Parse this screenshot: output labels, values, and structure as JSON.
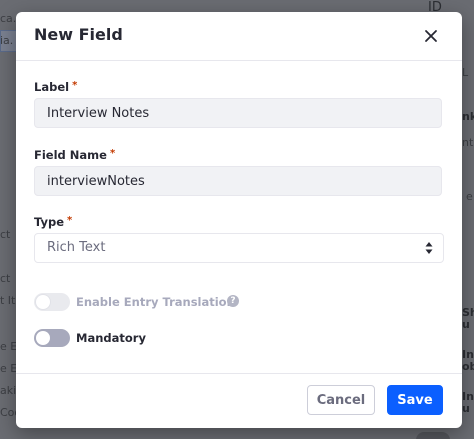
{
  "modal": {
    "title": "New Field",
    "close_icon": "close-icon"
  },
  "form": {
    "label_field": {
      "label": "Label",
      "required_mark": "*",
      "value": "Interview Notes"
    },
    "field_name": {
      "label": "Field Name",
      "required_mark": "*",
      "value": "interviewNotes"
    },
    "type_field": {
      "label": "Type",
      "required_mark": "*",
      "selected": "Rich Text",
      "icon": "select-arrows-icon"
    },
    "enable_entry_translation": {
      "label": "Enable Entry Translation",
      "enabled": false,
      "disabled": true,
      "help_icon": "question-circle-icon",
      "help_glyph": "?"
    },
    "mandatory": {
      "label": "Mandatory",
      "enabled": false
    }
  },
  "footer": {
    "cancel_label": "Cancel",
    "save_label": "Save"
  },
  "background": {
    "fragments": [
      "ID",
      "ca.",
      "ia.",
      "L",
      "nk",
      "nt",
      "e",
      "ct",
      "ct",
      "t It",
      "Sh",
      "u",
      "e E",
      "Ind",
      "e E",
      "ob",
      "akir",
      "Ind",
      "Coo",
      "u"
    ]
  },
  "colors": {
    "accent": "#0b5fff",
    "required": "#c33a00",
    "overlay": "#6a6c72"
  }
}
